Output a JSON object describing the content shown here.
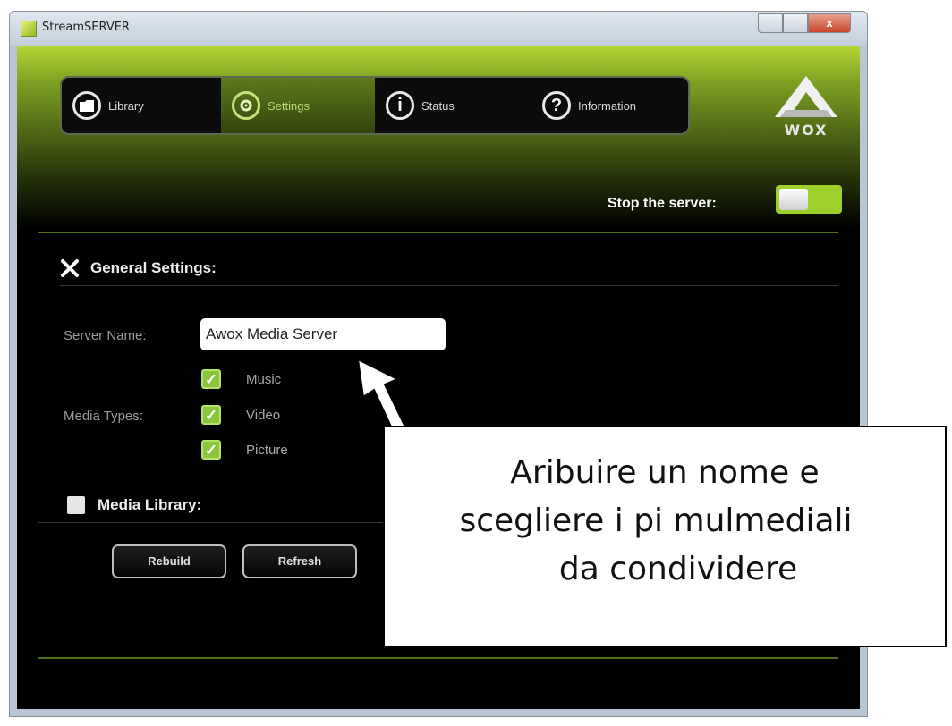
{
  "window": {
    "title": "StreamSERVER",
    "close_glyph": "x"
  },
  "nav": {
    "tabs": [
      {
        "label": "Library",
        "icon": "folder-icon",
        "active": false
      },
      {
        "label": "Settings",
        "icon": "settings-gear-icon",
        "active": true
      },
      {
        "label": "Status",
        "icon": "info-i-icon",
        "active": false
      },
      {
        "label": "Information",
        "icon": "question-mark-icon",
        "active": false
      }
    ]
  },
  "logo": {
    "text": "WOX",
    "brand_color": "#e8e8e8"
  },
  "server_control": {
    "label": "Stop the server:",
    "toggle_color": "#9dd02a"
  },
  "general_settings": {
    "title": "General Settings:",
    "server_name_label": "Server Name:",
    "server_name_value": "Awox Media Server",
    "media_types_label": "Media Types:",
    "media_types": [
      {
        "label": "Music",
        "checked": true
      },
      {
        "label": "Video",
        "checked": true
      },
      {
        "label": "Picture",
        "checked": true
      }
    ]
  },
  "media_library": {
    "title": "Media Library:",
    "rebuild_label": "Rebuild",
    "refresh_label": "Refresh"
  },
  "callout": {
    "line1": "Aribuire un nome e",
    "line2": "scegliere i pi mulmediali",
    "line3": "da condividere"
  },
  "colors": {
    "accent_green": "#8cc63f",
    "header_gradient_top": "#b6d636",
    "background": "#000000"
  }
}
